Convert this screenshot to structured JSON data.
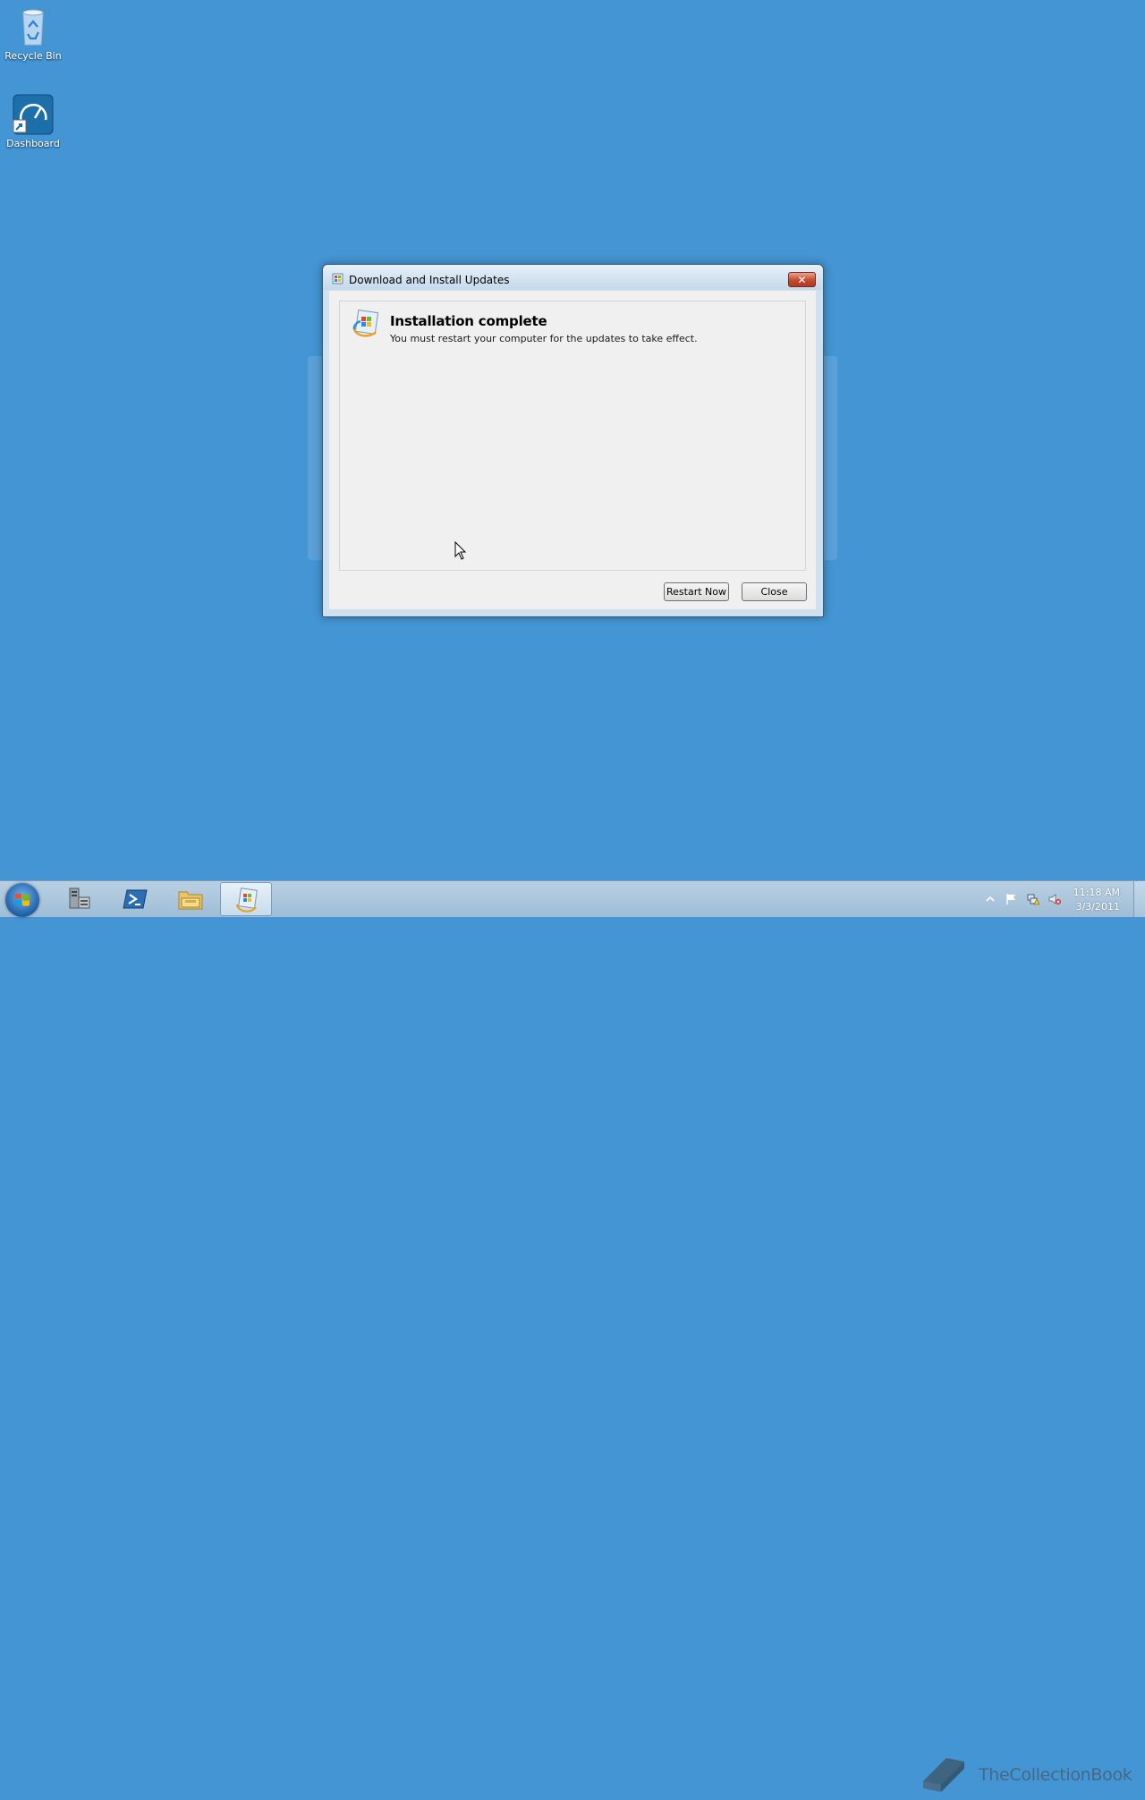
{
  "desktop": {
    "icons": [
      {
        "label": "Recycle Bin",
        "icon": "recycle-bin-icon"
      },
      {
        "label": "Dashboard",
        "icon": "dashboard-icon"
      }
    ]
  },
  "dialog": {
    "title": "Download and Install Updates",
    "close_label": "✕",
    "heading": "Installation complete",
    "message": "You must restart your computer for the updates to take effect.",
    "buttons": {
      "restart_label": "Restart Now",
      "close_label": "Close"
    }
  },
  "taskbar": {
    "apps": [
      {
        "icon": "server-manager-icon",
        "active": false
      },
      {
        "icon": "powershell-icon",
        "active": false
      },
      {
        "icon": "file-explorer-icon",
        "active": false
      },
      {
        "icon": "windows-update-icon",
        "active": true
      }
    ],
    "tray_icons": [
      "show-hidden-icons-icon",
      "action-center-flag-icon",
      "network-warning-icon",
      "volume-muted-icon"
    ],
    "clock": {
      "time": "11:18 AM",
      "date": "3/3/2011"
    }
  },
  "watermark": {
    "text": "TheCollectionBook"
  },
  "colors": {
    "desktop_background": "#4495d4",
    "dialog_frame": "#cfe0ee",
    "close_button": "#c7492e"
  }
}
